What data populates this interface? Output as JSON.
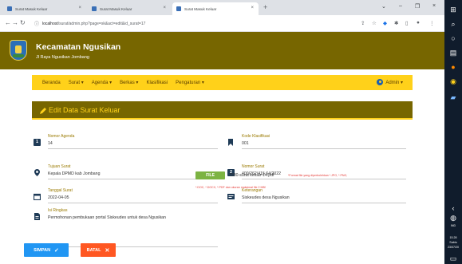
{
  "browser": {
    "tabs": [
      {
        "title": "Surat Masuk Keluar"
      },
      {
        "title": "Surat Masuk Keluar"
      },
      {
        "title": "Surat Masuk Keluar"
      }
    ],
    "url_host": "localhost",
    "url_path": "/surat/admin.php?page=sk&act=edit&id_surat=17"
  },
  "site": {
    "title": "Kecamatan Ngusikan",
    "subtitle": "Jl Raya Ngusikan Jombang",
    "nav": [
      {
        "label": "Beranda"
      },
      {
        "label": "Surat ▾"
      },
      {
        "label": "Agenda ▾"
      },
      {
        "label": "Berkas ▾"
      },
      {
        "label": "Klasifikasi"
      },
      {
        "label": "Pengaturan ▾"
      }
    ],
    "admin_label": "Admin ▾"
  },
  "form": {
    "title": "Edit Data Surat Keluar",
    "nomor_agenda": {
      "label": "Nomor Agenda",
      "value": "14"
    },
    "kode_klasifikasi": {
      "label": "Kode Klasifikasi",
      "value": "001"
    },
    "tujuan_surat": {
      "label": "Tujuan Surat",
      "value": "Kepala DPMD kab Jombang"
    },
    "nomor_surat": {
      "label": "Nomor Surat",
      "value": "400/262/415.64/2022"
    },
    "tanggal_surat": {
      "label": "Tanggal Surat",
      "value": "2022-04-05"
    },
    "keterangan": {
      "label": "Keterangan",
      "value": "Siskeudes desa Ngusikan"
    },
    "isi_ringkas": {
      "label": "Isi Ringkas",
      "value": "Permohonan pembukaan portal Siskeudes untuk desa Ngusikan"
    },
    "file_button": "FILE",
    "file_name": "7330-surat keluar-14.pdf",
    "file_note_1": "*Format file yang diperbolehkan *.JPG, *.PNG,",
    "file_note_2": "*.DOC, *.DOCX, *.PDF dan ukuran maksimal file 2 MB!",
    "save_label": "SIMPAN",
    "cancel_label": "BATAL"
  },
  "taskbar": {
    "lang": "IND",
    "time": "15.28",
    "day": "Sabtu",
    "date": "23/07/20"
  }
}
